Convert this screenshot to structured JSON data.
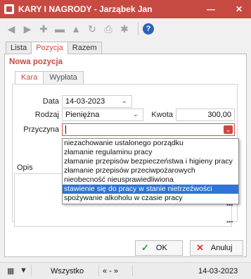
{
  "window": {
    "title": "KARY I NAGRODY - Jarząbek Jan",
    "minimize_glyph": "—",
    "close_glyph": "✕"
  },
  "toolbar": {
    "icons": [
      "first-icon",
      "next-icon",
      "add-icon",
      "remove-icon",
      "warning-icon",
      "refresh-icon",
      "print-icon",
      "settings-icon",
      "help-icon"
    ],
    "help_label": "?"
  },
  "tabs": [
    "Lista",
    "Pozycja",
    "Razem"
  ],
  "active_tab": "Pozycja",
  "section": {
    "title": "Nowa pozycja"
  },
  "subtabs": [
    "Kara",
    "Wypłata"
  ],
  "active_subtab": "Kara",
  "form": {
    "data_label": "Data",
    "data_value": "14-03-2023",
    "rodzaj_label": "Rodzaj",
    "rodzaj_value": "Pieniężna",
    "kwota_label": "Kwota",
    "kwota_value": "300,00",
    "przyczyna_label": "Przyczyna",
    "przyczyna_value": "",
    "opis_label": "Opis",
    "opis_value": ""
  },
  "przyczyna_options": [
    "niezachowanie ustalonego porządku",
    "złamanie regulaminu pracy",
    "złamanie przepisów bezpieczeństwa i higieny pracy",
    "złamanie przepisów przeciwpożarowych",
    "nieobecność nieusprawiedliwiona",
    "stawienie się do pracy w stanie nietrzeźwości",
    "spożywanie alkoholu w czasie pracy"
  ],
  "selected_option": "stawienie się do pracy w stanie nietrzeźwości",
  "buttons": {
    "ok_label": "OK",
    "cancel_label": "Anuluj"
  },
  "statusbar": {
    "filter_text": "Wszystko",
    "nav_text": "« -  »",
    "date": "14-03-2023"
  },
  "colors": {
    "accent": "#c74a42",
    "selection": "#2f74d6",
    "ok": "#2e9b3f",
    "cancel": "#d43a30"
  }
}
